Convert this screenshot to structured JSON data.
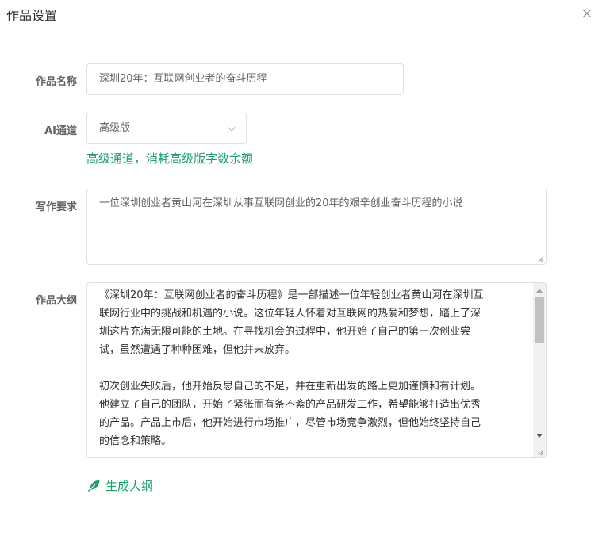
{
  "dialog": {
    "title": "作品设置"
  },
  "form": {
    "name": {
      "label": "作品名称",
      "value": "深圳20年：互联网创业者的奋斗历程"
    },
    "channel": {
      "label": "AI通道",
      "value": "高级版",
      "hint": "高级通道，消耗高级版字数余额"
    },
    "requirement": {
      "label": "写作要求",
      "value": "一位深圳创业者黄山河在深圳从事互联网创业的20年的艰辛创业奋斗历程的小说"
    },
    "outline": {
      "label": "作品大纲",
      "lines_p1": [
        "《深圳20年：互联网创业者的奋斗历程》是一部描述一位年轻创业者黄山河在深圳互",
        "联网行业中的挑战和机遇的小说。这位年轻人怀着对互联网的热爱和梦想，踏上了深",
        "圳这片充满无限可能的土地。在寻找机会的过程中，他开始了自己的第一次创业尝",
        "试，虽然遭遇了种种困难，但他并未放弃。"
      ],
      "lines_p2": [
        "初次创业失败后，他开始反思自己的不足，并在重新出发的路上更加谨慎和有计划。",
        "他建立了自己的团队，开始了紧张而有条不紊的产品研发工作，希望能够打造出优秀",
        "的产品。产品上市后，他开始进行市场推广，尽管市场竞争激烈，但他始终坚持自己",
        "的信念和策略。"
      ]
    }
  },
  "actions": {
    "generate_outline": "生成大纲"
  },
  "colors": {
    "accent": "#19a16a",
    "border": "#dcdfe6",
    "label": "#606266"
  },
  "icons": {
    "close": "close-icon",
    "dropdown": "chevron-down-icon",
    "generate": "feather-icon"
  }
}
